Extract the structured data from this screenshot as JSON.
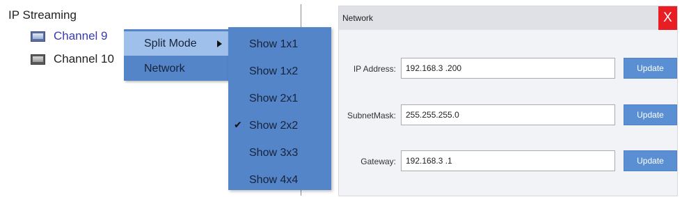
{
  "tree": {
    "root_label": "IP Streaming",
    "channels": [
      {
        "label": "Channel 9",
        "icon": "monitor-icon",
        "highlighted": true
      },
      {
        "label": "Channel 10",
        "icon": "monitor-icon",
        "highlighted": false
      }
    ]
  },
  "context_menu": {
    "items": [
      {
        "label": "Split Mode",
        "has_submenu": true,
        "active": true
      },
      {
        "label": "Network",
        "has_submenu": false,
        "active": false
      }
    ],
    "submenu": {
      "items": [
        {
          "label": "Show 1x1",
          "checked": false
        },
        {
          "label": "Show 1x2",
          "checked": false
        },
        {
          "label": "Show 2x1",
          "checked": false
        },
        {
          "label": "Show 2x2",
          "checked": true
        },
        {
          "label": "Show 3x3",
          "checked": false
        },
        {
          "label": "Show 4x4",
          "checked": false
        }
      ]
    }
  },
  "dialog": {
    "title": "Network",
    "close_label": "X",
    "fields": [
      {
        "label": "IP Address:",
        "value": "192.168.3 .200",
        "button": "Update"
      },
      {
        "label": "SubnetMask:",
        "value": "255.255.255.0",
        "button": "Update"
      },
      {
        "label": "Gateway:",
        "value": "192.168.3 .1",
        "button": "Update"
      }
    ]
  },
  "colors": {
    "menu_bg": "#5585c9",
    "menu_highlight": "#9ec0ea",
    "button_blue": "#5b8fd4",
    "close_red": "#e81e22",
    "channel_active_text": "#3a3ab0"
  }
}
